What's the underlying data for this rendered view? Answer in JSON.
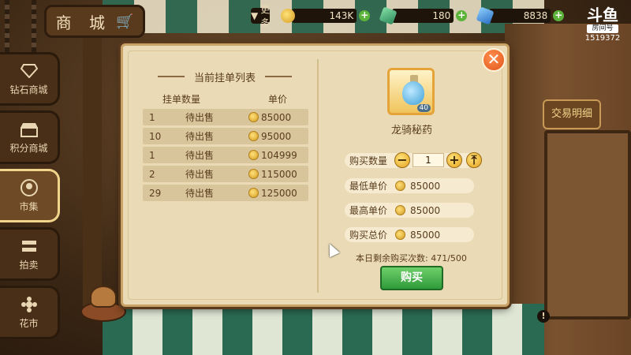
{
  "shop_sign": {
    "label": "商 城"
  },
  "topbar": {
    "more_label": "更多",
    "resources": [
      {
        "icon": "gold-coin-icon",
        "value": "143K"
      },
      {
        "icon": "jade-icon",
        "value": "180"
      },
      {
        "icon": "crystal-icon",
        "value": "8838"
      }
    ]
  },
  "stream_logo": {
    "mark": "斗鱼",
    "room_label": "房间号",
    "room_number": "1519372"
  },
  "sidebar": {
    "items": [
      {
        "label": "钻石商城",
        "icon": "diamond-icon"
      },
      {
        "label": "积分商城",
        "icon": "shop-icon"
      },
      {
        "label": "市集",
        "icon": "market-icon",
        "active": true
      },
      {
        "label": "拍卖",
        "icon": "auction-icon"
      },
      {
        "label": "花市",
        "icon": "flower-icon"
      }
    ]
  },
  "trade_detail_button": "交易明细",
  "listing": {
    "title": "当前挂单列表",
    "col_qty": "挂单数量",
    "col_price": "单价",
    "rows": [
      {
        "qty": "1",
        "status": "待出售",
        "price": "85000"
      },
      {
        "qty": "10",
        "status": "待出售",
        "price": "95000"
      },
      {
        "qty": "1",
        "status": "待出售",
        "price": "104999"
      },
      {
        "qty": "2",
        "status": "待出售",
        "price": "115000"
      },
      {
        "qty": "29",
        "status": "待出售",
        "price": "125000"
      }
    ]
  },
  "item": {
    "name": "龙骑秘药",
    "badge": "40"
  },
  "purchase": {
    "qty_label": "购买数量",
    "qty_value": "1",
    "min_price_label": "最低单价",
    "min_price": "85000",
    "max_price_label": "最高单价",
    "max_price": "85000",
    "total_label": "购买总价",
    "total": "85000",
    "remaining_text": "本日剩余购买次数: 471/500",
    "buy_label": "购买"
  },
  "colors": {
    "buy_green": "#2f9a3a",
    "close_orange": "#e0541c",
    "accent_gold": "#e4a21f"
  }
}
